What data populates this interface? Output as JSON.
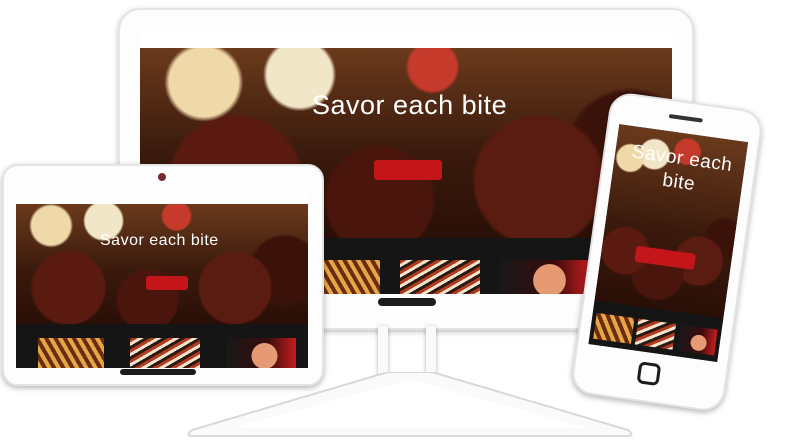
{
  "site": {
    "nav_items": [
      "",
      "",
      ""
    ],
    "hero_title": "Savor each bite",
    "phone_hero_title": "Savor each bite",
    "hero_subtitle": "",
    "cta_label": ""
  },
  "colors": {
    "accent": "#c3151a",
    "frame": "#fdfdfd",
    "screen_dark": "#151515"
  },
  "devices": [
    "monitor",
    "tablet",
    "phone"
  ]
}
